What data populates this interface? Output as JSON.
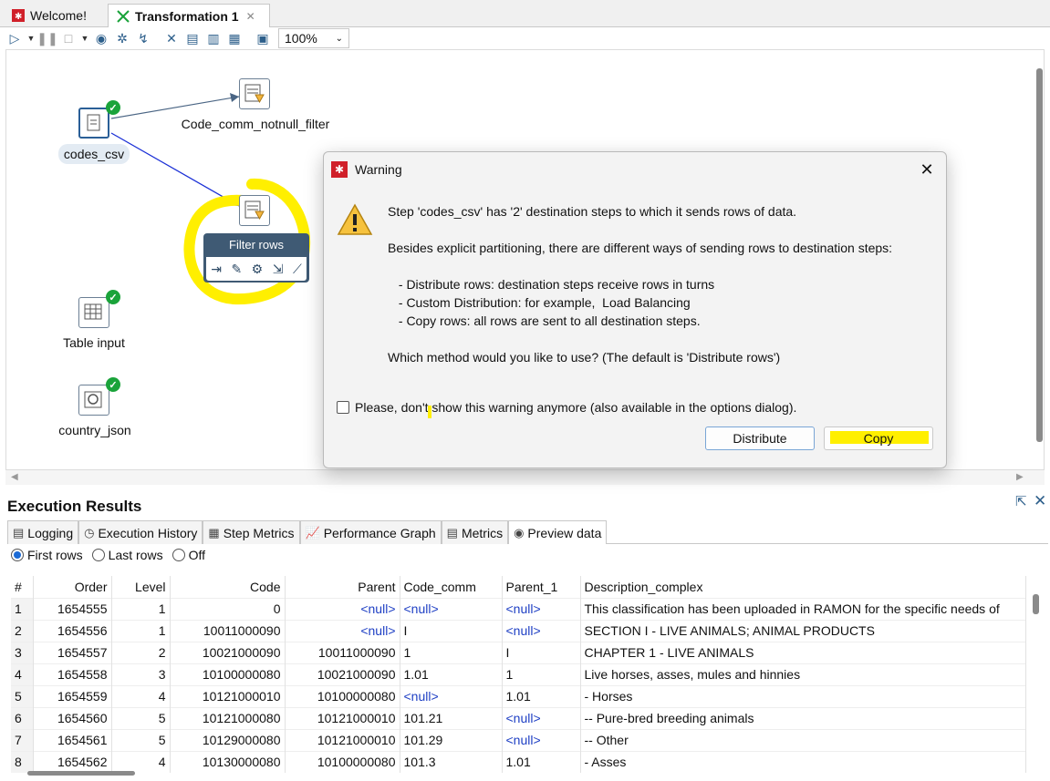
{
  "tabs": [
    {
      "label": "Welcome!",
      "icon": "kettle-icon"
    },
    {
      "label": "Transformation 1",
      "icon": "transformation-icon",
      "close": "✕"
    }
  ],
  "toolbar": {
    "zoom": "100%"
  },
  "canvas": {
    "steps": {
      "codes_csv": "codes_csv",
      "code_comm": "Code_comm_notnull_filter",
      "table_input": "Table input",
      "country_json": "country_json",
      "filter_rows_tooltip": "Filter rows"
    }
  },
  "dialog": {
    "title": "Warning",
    "line1": "Step 'codes_csv' has '2' destination steps to which it sends rows of data.",
    "line2": "Besides explicit partitioning, there are different ways of sending rows to destination steps:",
    "bullet1": " - Distribute rows: destination steps receive rows in turns",
    "bullet2": " - Custom Distribution: for example,  Load Balancing",
    "bullet3": " - Copy rows: all rows are sent to all destination steps.",
    "question": "Which method would you like to use? (The default is 'Distribute rows')",
    "checkbox_label": "Please, don't show this warning anymore (also available in the options dialog).",
    "distribute_label": "Distribute",
    "copy_label": "Copy"
  },
  "exec": {
    "title": "Execution Results",
    "tabs": [
      "Logging",
      "Execution History",
      "Step Metrics",
      "Performance Graph",
      "Metrics",
      "Preview data"
    ],
    "radios": [
      "First rows",
      "Last rows",
      "Off"
    ],
    "columns": [
      "#",
      "Order",
      "Level",
      "Code",
      "Parent",
      "Code_comm",
      "Parent_1",
      "Description_complex"
    ],
    "rows": [
      [
        "1",
        "1654555",
        "1",
        "0",
        "<null>",
        "<null>",
        "<null>",
        "This classification has been uploaded in RAMON for the specific needs of"
      ],
      [
        "2",
        "1654556",
        "1",
        "10011000090",
        "<null>",
        "I",
        "<null>",
        "SECTION I - LIVE ANIMALS; ANIMAL PRODUCTS"
      ],
      [
        "3",
        "1654557",
        "2",
        "10021000090",
        "10011000090",
        "1",
        "I",
        "CHAPTER 1 - LIVE ANIMALS"
      ],
      [
        "4",
        "1654558",
        "3",
        "10100000080",
        "10021000090",
        "1.01",
        "1",
        "Live horses, asses, mules and hinnies"
      ],
      [
        "5",
        "1654559",
        "4",
        "10121000010",
        "10100000080",
        "<null>",
        "1.01",
        "- Horses"
      ],
      [
        "6",
        "1654560",
        "5",
        "10121000080",
        "10121000010",
        "101.21",
        "<null>",
        "-- Pure-bred breeding animals"
      ],
      [
        "7",
        "1654561",
        "5",
        "10129000080",
        "10121000010",
        "101.29",
        "<null>",
        "-- Other"
      ],
      [
        "8",
        "1654562",
        "4",
        "10130000080",
        "10100000080",
        "101.3",
        "1.01",
        "- Asses"
      ]
    ]
  },
  "colors": {
    "highlight": "#ffef00",
    "accent": "#1b6bd6",
    "null_text": "#1e3fc4",
    "check": "#1aa33a"
  }
}
